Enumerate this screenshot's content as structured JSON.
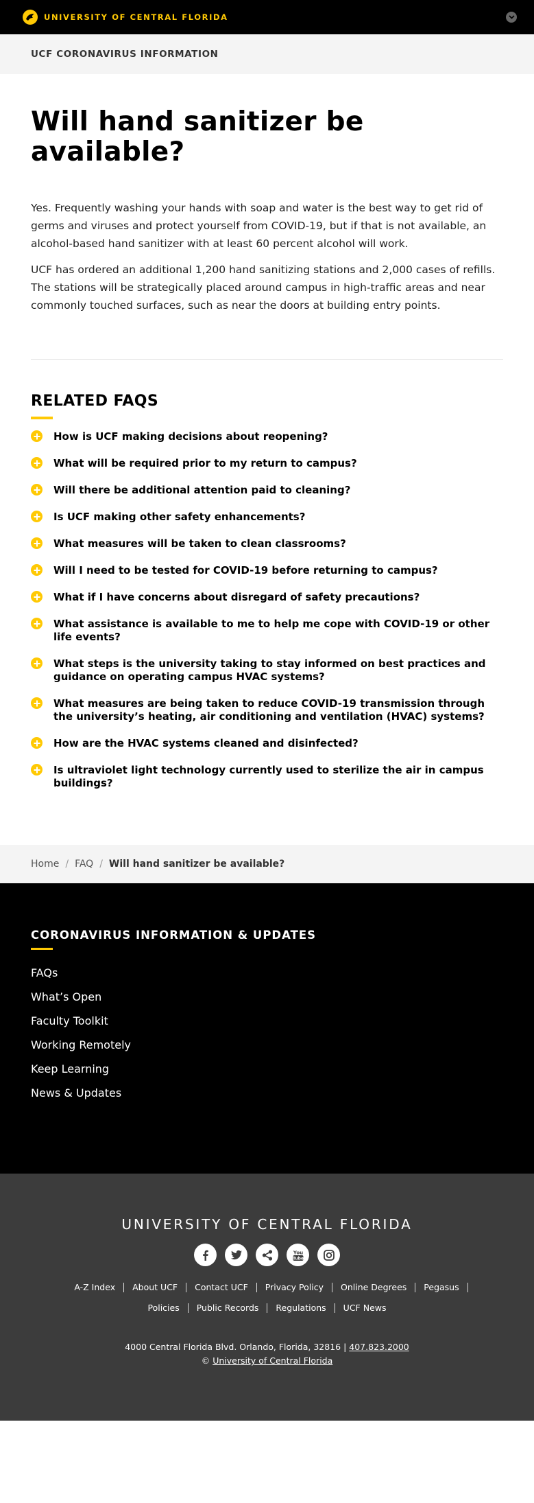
{
  "topbar": {
    "brand": "UNIVERSITY OF CENTRAL FLORIDA",
    "toggle_icon": "chevron-down-icon",
    "brand_color": "#ffc904"
  },
  "site_header": {
    "title": "UCF CORONAVIRUS INFORMATION"
  },
  "article": {
    "title": "Will hand sanitizer be available?",
    "paragraphs": [
      "Yes. Frequently washing your hands with soap and water is the best way to get rid of germs and viruses and protect yourself from COVID-19, but if that is not available, an alcohol-based hand sanitizer with at least 60 percent alcohol will work.",
      "UCF has ordered an additional 1,200 hand sanitizing stations and 2,000 cases of refills. The stations will be strategically placed around campus in high-traffic areas and near commonly touched surfaces, such as near the doors at building entry points."
    ]
  },
  "related": {
    "title": "RELATED FAQS",
    "icon": "plus-circle-icon",
    "items": [
      "How is UCF making decisions about reopening?",
      "What will be required prior to my return to campus?",
      "Will there be additional attention paid to cleaning?",
      "Is UCF making other safety enhancements?",
      "What measures will be taken to clean classrooms?",
      "Will I need to be tested for COVID-19 before returning to campus?",
      "What if I have concerns about disregard of safety precautions?",
      "What assistance is available to me to help me cope with COVID-19 or other life events?",
      "What steps is the university taking to stay informed on best practices and guidance on operating campus HVAC systems?",
      "What measures are being taken to reduce COVID-19 transmission through the university’s heating, air conditioning and ventilation (HVAC) systems?",
      "How are the HVAC systems cleaned and disinfected?",
      "Is ultraviolet light technology currently used to sterilize the air in campus buildings?"
    ]
  },
  "breadcrumb": {
    "home": "Home",
    "faq": "FAQ",
    "current": "Will hand sanitizer be available?"
  },
  "footer_black": {
    "title": "CORONAVIRUS INFORMATION & UPDATES",
    "links": [
      "FAQs",
      "What’s Open",
      "Faculty Toolkit",
      "Working Remotely",
      "Keep Learning",
      "News & Updates"
    ]
  },
  "footer_grey": {
    "university": "UNIVERSITY OF CENTRAL FLORIDA",
    "social": [
      "facebook-icon",
      "twitter-icon",
      "share-icon",
      "youtube-icon",
      "instagram-icon"
    ],
    "links_row1": [
      "A-Z Index",
      "About UCF",
      "Contact UCF",
      "Privacy Policy",
      "Online Degrees",
      "Pegasus"
    ],
    "links_row2": [
      "Policies",
      "Public Records",
      "Regulations",
      "UCF News"
    ],
    "address": "4000 Central Florida Blvd. Orlando, Florida, 32816 |",
    "phone": "407.823.2000",
    "copyright_symbol": "©",
    "copyright_link": "University of Central Florida"
  }
}
